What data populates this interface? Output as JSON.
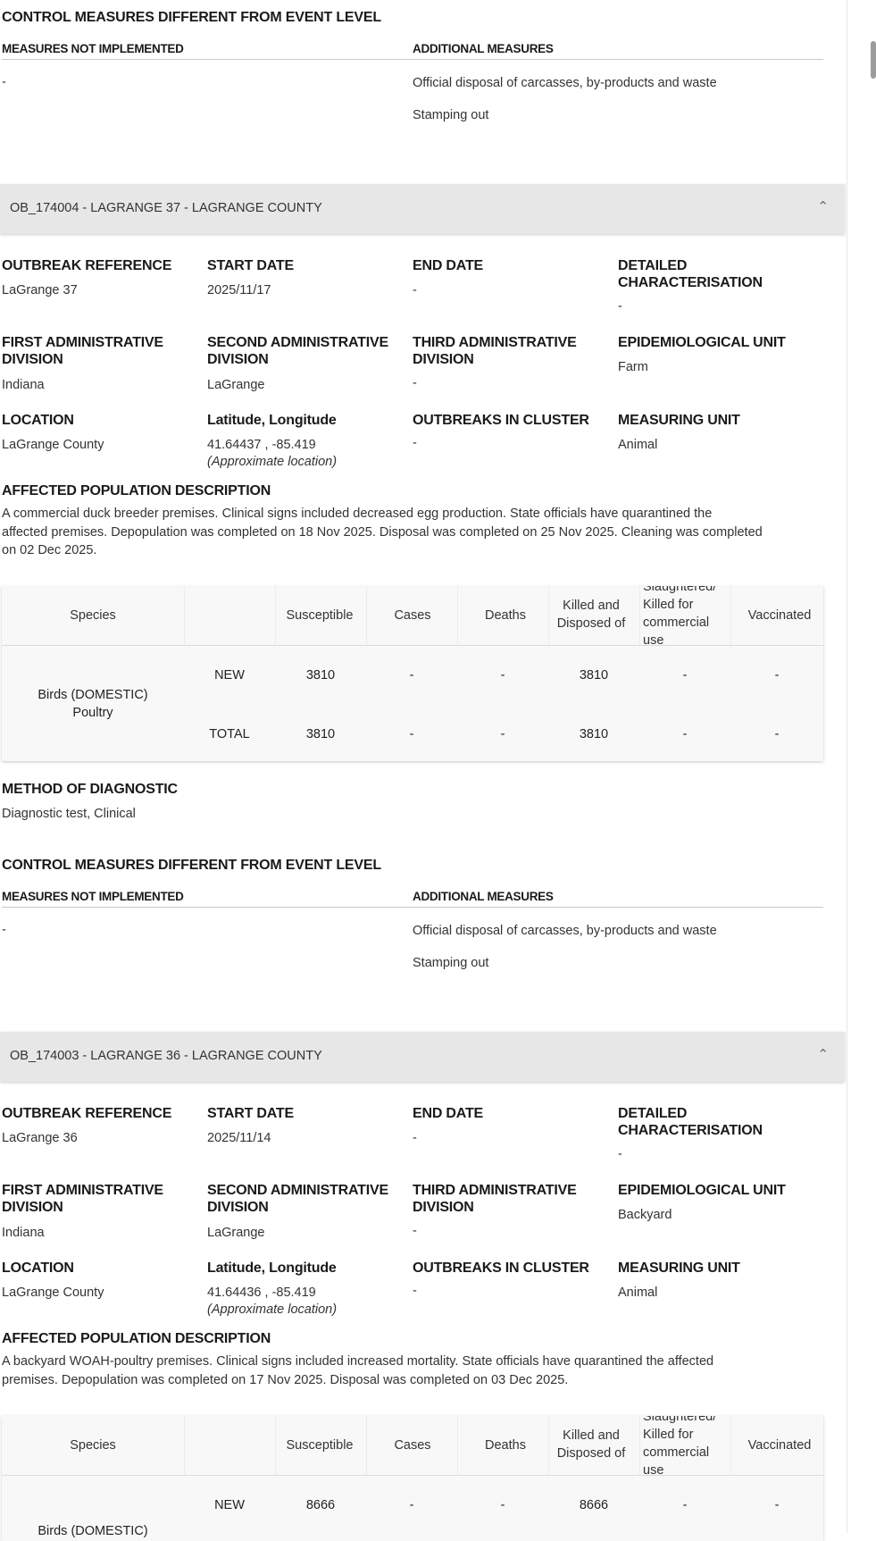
{
  "top_section": {
    "control_title": "CONTROL MEASURES DIFFERENT FROM EVENT LEVEL",
    "not_impl_label": "MEASURES NOT IMPLEMENTED",
    "additional_label": "ADDITIONAL MEASURES",
    "not_impl_value": "-",
    "additional_items": [
      "Official disposal of carcasses, by-products and waste",
      "Stamping out"
    ]
  },
  "labels": {
    "outbreak_reference": "OUTBREAK REFERENCE",
    "start_date": "START DATE",
    "end_date": "END DATE",
    "detailed_char": "DETAILED CHARACTERISATION",
    "first_admin": "FIRST ADMINISTRATIVE DIVISION",
    "second_admin": "SECOND ADMINISTRATIVE DIVISION",
    "third_admin": "THIRD ADMINISTRATIVE DIVISION",
    "epi_unit": "EPIDEMIOLOGICAL UNIT",
    "location": "LOCATION",
    "lat_long": "Latitude, Longitude",
    "outbreaks_cluster": "OUTBREAKS IN CLUSTER",
    "measuring_unit": "MEASURING UNIT",
    "affected_pop": "AFFECTED POPULATION DESCRIPTION",
    "method_diag": "METHOD OF DIAGNOSTIC",
    "control_title": "CONTROL MEASURES DIFFERENT FROM EVENT LEVEL",
    "not_impl": "MEASURES NOT IMPLEMENTED",
    "additional": "ADDITIONAL MEASURES",
    "approx": "(Approximate location)"
  },
  "table_headers": {
    "species": "Species",
    "susceptible": "Susceptible",
    "cases": "Cases",
    "deaths": "Deaths",
    "killed": "Killed and Disposed of",
    "slaughtered": "Slaughtered/ Killed for commercial use",
    "vaccinated": "Vaccinated"
  },
  "outbreaks": [
    {
      "title": "OB_174004 - LAGRANGE 37 - LAGRANGE COUNTY",
      "outbreak_reference": "LaGrange 37",
      "start_date": "2025/11/17",
      "end_date": "-",
      "detailed_char": "-",
      "first_admin": "Indiana",
      "second_admin": "LaGrange",
      "third_admin": "-",
      "epi_unit": "Farm",
      "location": "LaGrange County",
      "lat_long": "41.64437 , -85.419",
      "outbreaks_cluster": "-",
      "measuring_unit": "Animal",
      "affected_pop_lines": [
        "A commercial duck breeder premises. Clinical signs included decreased egg production. State officials have quarantined the",
        "affected premises. Depopulation was completed on 18 Nov 2025. Disposal was completed on 25 Nov 2025. Cleaning was completed",
        "on 02 Dec 2025."
      ],
      "species": [
        "Birds (DOMESTIC)",
        "Poultry"
      ],
      "rows": [
        {
          "type": "NEW",
          "susceptible": "3810",
          "cases": "-",
          "deaths": "-",
          "killed": "3810",
          "slaughtered": "-",
          "vaccinated": "-"
        },
        {
          "type": "TOTAL",
          "susceptible": "3810",
          "cases": "-",
          "deaths": "-",
          "killed": "3810",
          "slaughtered": "-",
          "vaccinated": "-"
        }
      ],
      "method_diag": "Diagnostic test, Clinical",
      "not_impl_value": "-",
      "additional_items": [
        "Official disposal of carcasses, by-products and waste",
        "Stamping out"
      ]
    },
    {
      "title": "OB_174003 - LAGRANGE 36 - LAGRANGE COUNTY",
      "outbreak_reference": "LaGrange 36",
      "start_date": "2025/11/14",
      "end_date": "-",
      "detailed_char": "-",
      "first_admin": "Indiana",
      "second_admin": "LaGrange",
      "third_admin": "-",
      "epi_unit": "Backyard",
      "location": "LaGrange County",
      "lat_long": "41.64436 , -85.419",
      "outbreaks_cluster": "-",
      "measuring_unit": "Animal",
      "affected_pop_lines": [
        "A backyard WOAH-poultry premises. Clinical signs included increased mortality. State officials have quarantined the affected",
        "premises. Depopulation was completed on 17 Nov 2025. Disposal was completed on 03 Dec 2025."
      ],
      "species": [
        "Birds (DOMESTIC)"
      ],
      "rows": [
        {
          "type": "NEW",
          "susceptible": "8666",
          "cases": "-",
          "deaths": "-",
          "killed": "8666",
          "slaughtered": "-",
          "vaccinated": "-"
        }
      ]
    }
  ]
}
